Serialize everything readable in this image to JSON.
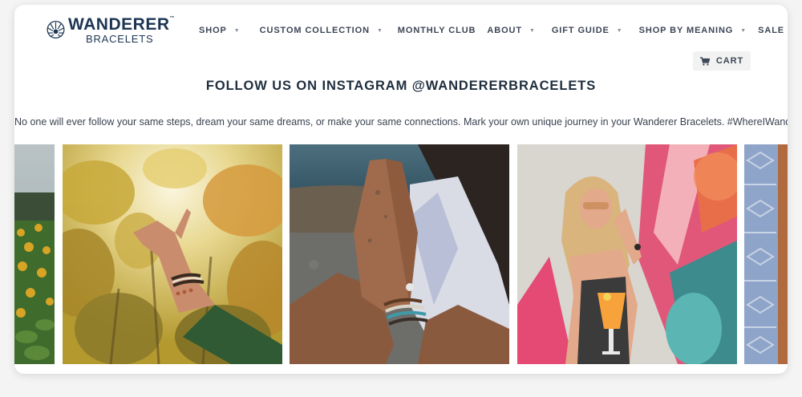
{
  "brand": {
    "logo_word": "WANDERER",
    "logo_sub": "BRACELETS",
    "tm": "™",
    "color": "#1d3553"
  },
  "nav": {
    "items": [
      {
        "label": "SHOP",
        "has_dropdown": true
      },
      {
        "label": "CUSTOM COLLECTION",
        "has_dropdown": true
      },
      {
        "label": "MONTHLY CLUB",
        "has_dropdown": false
      },
      {
        "label": "ABOUT",
        "has_dropdown": true
      },
      {
        "label": "GIFT GUIDE",
        "has_dropdown": true
      },
      {
        "label": "SHOP BY MEANING",
        "has_dropdown": true
      },
      {
        "label": "SALE",
        "has_dropdown": false
      }
    ],
    "caret": "▼",
    "icons": [
      "user-icon",
      "search-icon"
    ]
  },
  "cart": {
    "label": "CART",
    "icon": "cart-icon"
  },
  "instagram": {
    "title": "FOLLOW US ON INSTAGRAM @WANDERERBRACELETS",
    "description": "No one will ever follow your same steps, dream your same dreams, or make your same connections. Mark your own unique journey in your Wanderer Bracelets. #WhereIWander"
  },
  "gallery": {
    "photos": [
      {
        "name": "sunflower-field-photo"
      },
      {
        "name": "autumn-hand-bracelets-photo"
      },
      {
        "name": "praying-hands-bracelets-photo"
      },
      {
        "name": "woman-mural-drink-photo"
      },
      {
        "name": "blue-pattern-photo"
      }
    ]
  },
  "colors": {
    "text_dark": "#1f2d3d",
    "nav_text": "#3c4656",
    "cart_bg": "#f2f2f2"
  }
}
